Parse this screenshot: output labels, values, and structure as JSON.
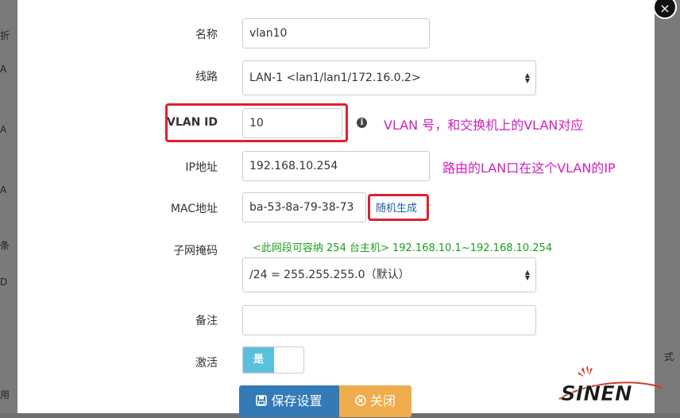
{
  "close_icon": "×",
  "backdrop_left": [
    "折",
    "A",
    "A",
    "A",
    "条",
    "D",
    "用"
  ],
  "backdrop_right": "式",
  "form": {
    "name": {
      "label": "名称",
      "value": "vlan10"
    },
    "line": {
      "label": "线路",
      "value": "LAN-1   <lan1/lan1/172.16.0.2>"
    },
    "vlan_id": {
      "label": "VLAN ID",
      "value": "10"
    },
    "ip": {
      "label": "IP地址",
      "value": "192.168.10.254"
    },
    "mac": {
      "label": "MAC地址",
      "value": "ba-53-8a-79-38-73",
      "generate_label": "随机生成"
    },
    "subnet": {
      "label": "子网掩码",
      "hint": "<此网段可容纳 254 台主机> 192.168.10.1~192.168.10.254",
      "value": "/24 = 255.255.255.0（默认）"
    },
    "remark": {
      "label": "备注",
      "value": ""
    },
    "active": {
      "label": "激活",
      "toggle_label": "是",
      "state": true
    }
  },
  "annotations": {
    "vlan_id_note": "VLAN 号，和交换机上的VLAN对应",
    "ip_note": "路由的LAN口在这个VLAN的IP"
  },
  "buttons": {
    "save_label": "保存设置",
    "close_label": "关闭"
  },
  "icons": {
    "info": "info-icon",
    "save": "floppy-icon",
    "close": "x-circle-icon"
  },
  "logo": {
    "text": "SINEN"
  },
  "colors": {
    "annotation": "#d11fbf",
    "highlight_box": "#e0202e",
    "hint": "#1c9e1c",
    "save_button": "#337ab7",
    "close_button": "#f0ad4e",
    "toggle_on": "#5bc0de"
  }
}
